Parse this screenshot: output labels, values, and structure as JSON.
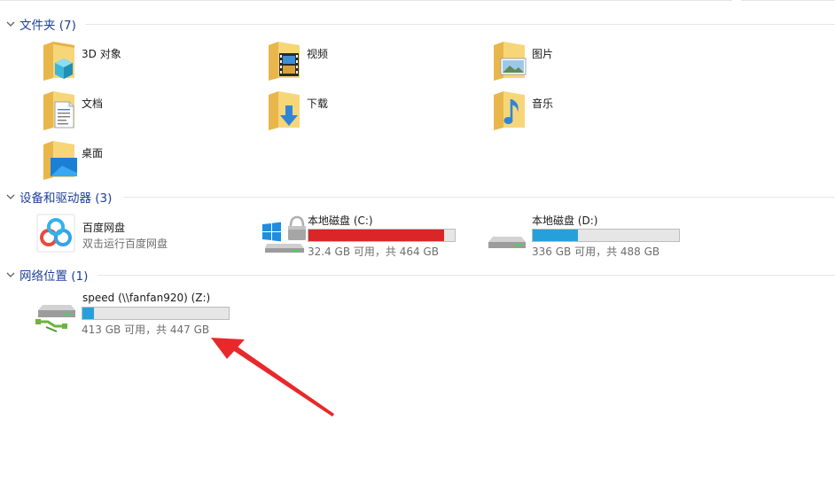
{
  "colors": {
    "accent": "#1e3f9a",
    "bar_normal": "#26a0da",
    "bar_full": "#da2626",
    "bar_bg": "#e6e6e6",
    "annotation_arrow": "#e8282a"
  },
  "sections": {
    "folders": {
      "title": "文件夹 (7)"
    },
    "devices": {
      "title": "设备和驱动器 (3)"
    },
    "network": {
      "title": "网络位置 (1)"
    }
  },
  "folders": [
    {
      "name": "3D 对象",
      "icon": "3d-objects-folder-icon"
    },
    {
      "name": "视频",
      "icon": "videos-folder-icon"
    },
    {
      "name": "图片",
      "icon": "pictures-folder-icon"
    },
    {
      "name": "文档",
      "icon": "documents-folder-icon"
    },
    {
      "name": "下载",
      "icon": "downloads-folder-icon"
    },
    {
      "name": "音乐",
      "icon": "music-folder-icon"
    },
    {
      "name": "桌面",
      "icon": "desktop-folder-icon"
    }
  ],
  "devices": {
    "baidu": {
      "name": "百度网盘",
      "subtitle": "双击运行百度网盘",
      "icon": "baidu-netdisk-icon"
    },
    "c_drive": {
      "name": "本地磁盘 (C:)",
      "space": "32.4 GB 可用，共 464 GB",
      "used_fraction": 0.93,
      "icon": "windows-system-drive-icon"
    },
    "d_drive": {
      "name": "本地磁盘 (D:)",
      "space": "336 GB 可用，共 488 GB",
      "used_fraction": 0.31,
      "icon": "hard-drive-icon"
    }
  },
  "network": {
    "z_drive": {
      "name": "speed (\\\\fanfan920) (Z:)",
      "space": "413 GB 可用，共 447 GB",
      "used_fraction": 0.08,
      "icon": "network-drive-icon"
    }
  }
}
